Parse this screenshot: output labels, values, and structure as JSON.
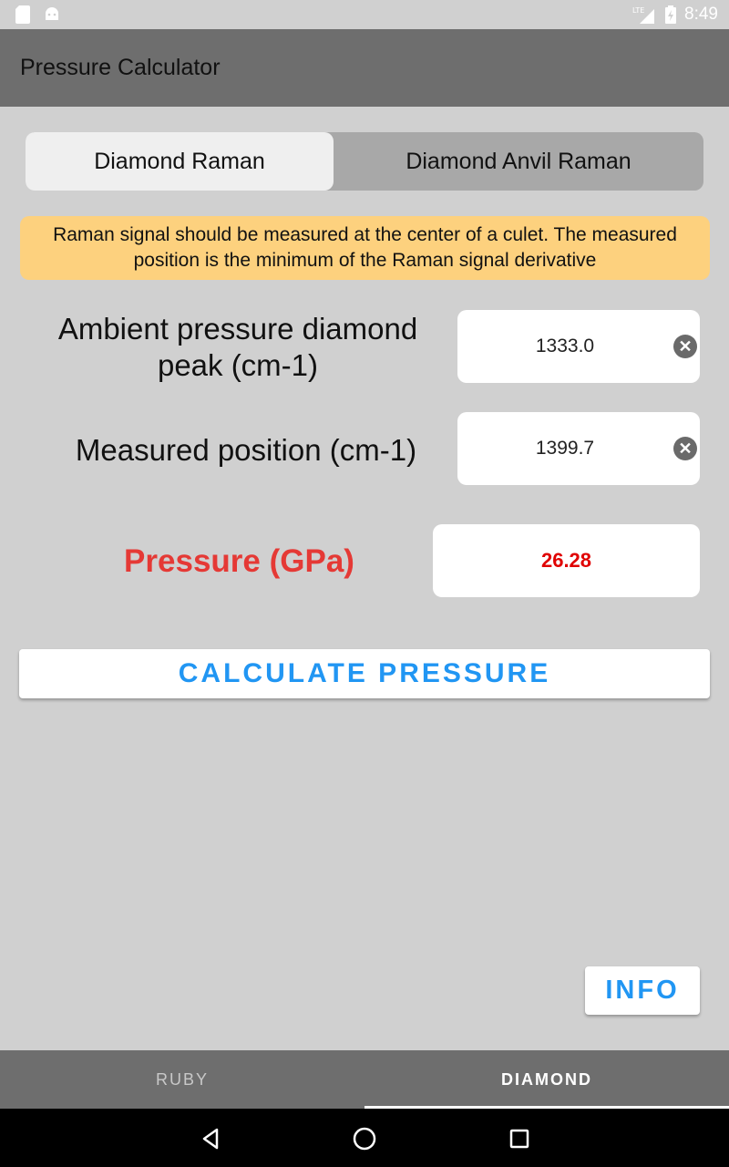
{
  "status_bar": {
    "time": "8:49",
    "network": "LTE"
  },
  "app_bar": {
    "title": "Pressure Calculator"
  },
  "segmented": {
    "options": [
      "Diamond Raman",
      "Diamond Anvil Raman"
    ],
    "selected": "Diamond Raman"
  },
  "notice": {
    "text": "Raman signal should be measured at the center of a culet. The measured position is the minimum of the Raman signal derivative"
  },
  "fields": {
    "ambient": {
      "label": "Ambient pressure diamond peak (cm-1)",
      "value": "1333.0"
    },
    "measured": {
      "label": "Measured position (cm-1)",
      "value": "1399.7"
    }
  },
  "result": {
    "label": "Pressure (GPa)",
    "value": "26.28"
  },
  "buttons": {
    "calculate": "CALCULATE PRESSURE",
    "info": "INFO"
  },
  "tabs": {
    "items": [
      "RUBY",
      "DIAMOND"
    ],
    "selected": "DIAMOND"
  },
  "colors": {
    "accent": "#2196f3",
    "pressure_label": "#e53935",
    "result_value": "#e00000",
    "notice_bg": "#fdd17e",
    "app_bar": "#6e6e6e",
    "background": "#d0d0d0"
  }
}
